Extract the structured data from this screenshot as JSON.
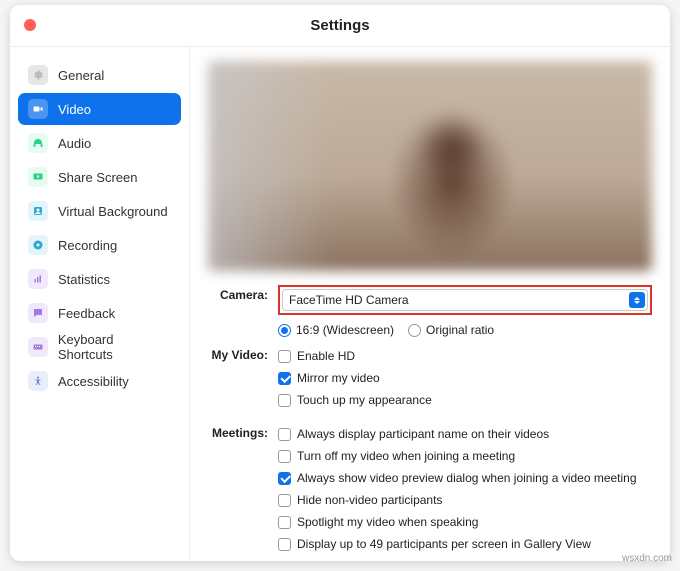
{
  "window": {
    "title": "Settings"
  },
  "sidebar": {
    "items": [
      {
        "label": "General"
      },
      {
        "label": "Video"
      },
      {
        "label": "Audio"
      },
      {
        "label": "Share Screen"
      },
      {
        "label": "Virtual Background"
      },
      {
        "label": "Recording"
      },
      {
        "label": "Statistics"
      },
      {
        "label": "Feedback"
      },
      {
        "label": "Keyboard Shortcuts"
      },
      {
        "label": "Accessibility"
      }
    ]
  },
  "camera": {
    "label": "Camera:",
    "selected": "FaceTime HD Camera"
  },
  "aspect": {
    "wide": "16:9 (Widescreen)",
    "orig": "Original ratio"
  },
  "myvideo": {
    "label": "My Video:",
    "enable_hd": "Enable HD",
    "mirror": "Mirror my video",
    "touchup": "Touch up my appearance"
  },
  "meetings": {
    "label": "Meetings:",
    "names": "Always display participant name on their videos",
    "turnoff": "Turn off my video when joining a meeting",
    "preview": "Always show video preview dialog when joining a video meeting",
    "hide_nonvideo": "Hide non-video participants",
    "spotlight": "Spotlight my video when speaking",
    "gallery49": "Display up to 49 participants per screen in Gallery View"
  },
  "watermark": "wsxdn.com"
}
